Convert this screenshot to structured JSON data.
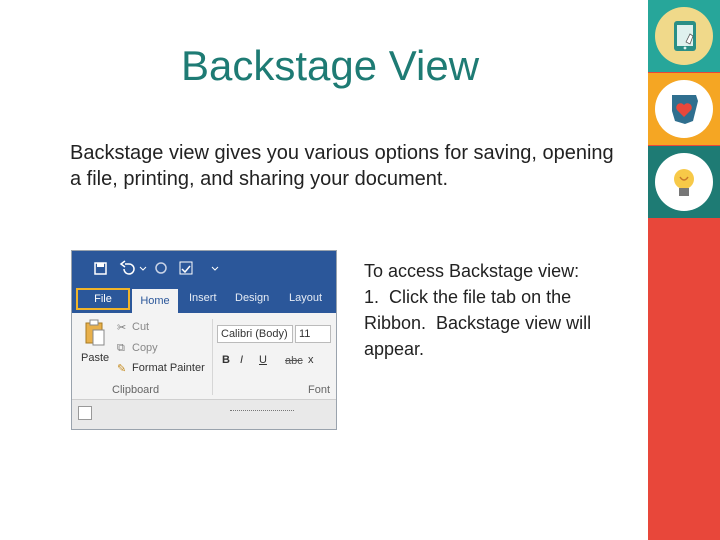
{
  "slide": {
    "title": "Backstage View",
    "body": "Backstage view gives you various options for saving, opening a file, printing, and sharing your document.",
    "side_lines": [
      "To access Backstage view:",
      "1.  Click the file tab on the",
      "Ribbon.  Backstage view will",
      "appear."
    ]
  },
  "ribbon": {
    "tabs": [
      "File",
      "Home",
      "Insert",
      "Design",
      "Layout"
    ],
    "clipboard": {
      "paste": "Paste",
      "cut": "Cut",
      "copy": "Copy",
      "format_painter": "Format Painter",
      "group_label": "Clipboard"
    },
    "font": {
      "font_name": "Calibri (Body)",
      "font_size": "11",
      "bold": "B",
      "italic": "I",
      "underline": "U",
      "strike": "abc",
      "subscript": "x",
      "group_label": "Font"
    },
    "colors": {
      "ribbon_blue": "#2b579a",
      "highlight": "#f0b429"
    }
  },
  "side_icons": [
    "tablet-touch-icon",
    "ohio-heart-icon",
    "lightbulb-icon"
  ],
  "colors": {
    "title": "#1e7b74",
    "bar_red": "#e8473a",
    "tile_teal": "#27a69a",
    "tile_orange": "#f5a623",
    "tile_dark_teal": "#1e7b74"
  }
}
